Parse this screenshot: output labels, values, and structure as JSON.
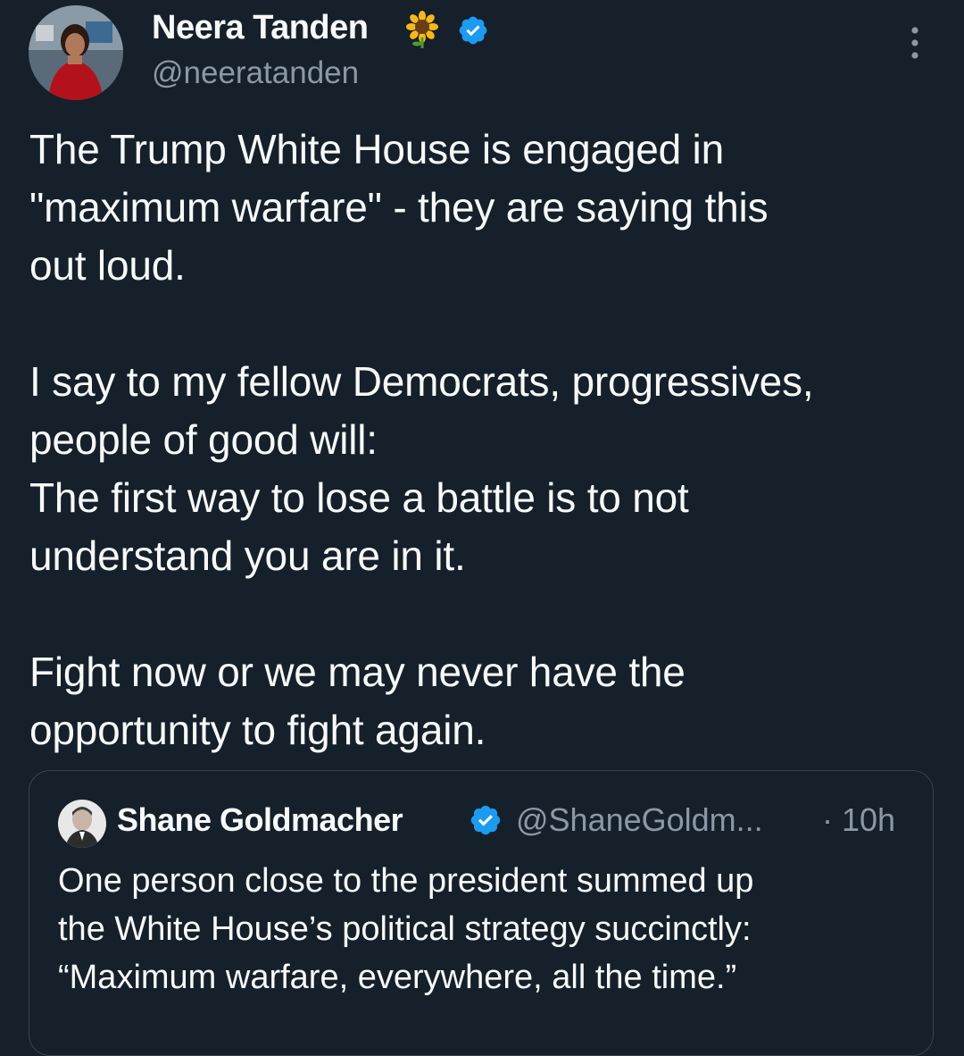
{
  "tweet": {
    "author_name": "Neera Tanden",
    "author_emoji_icon": "sunflower-icon",
    "verified_icon": "verified-badge-icon",
    "handle": "@neeratanden",
    "more_icon": "more-options-icon",
    "body_lines": [
      "The Trump White House is engaged in",
      "\"maximum warfare\" - they are saying this",
      "out loud.",
      "",
      "I say to my fellow Democrats, progressives,",
      "people of good will:",
      "The first way to lose a battle is to not",
      "understand you are in it.",
      "",
      "Fight now or we may never have the",
      "opportunity to fight again."
    ]
  },
  "quote": {
    "author_name": "Shane Goldmacher",
    "verified_icon": "verified-badge-icon",
    "handle": "@ShaneGoldm...",
    "separator": "·",
    "time": "10h",
    "text_lines": [
      "One person close to the president summed up",
      "the White House’s political strategy succinctly:",
      "“Maximum warfare, everywhere, all the time.”"
    ]
  },
  "colors": {
    "background": "#15202b",
    "text_primary": "#f7f9f9",
    "text_secondary": "#8b98a5",
    "verified_blue": "#1d9bf0",
    "border": "#38444d"
  }
}
